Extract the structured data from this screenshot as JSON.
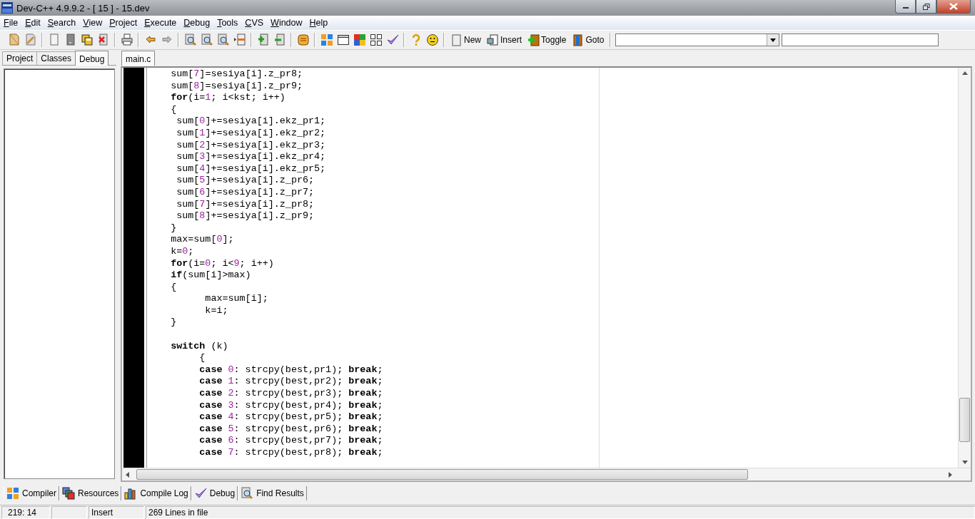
{
  "window": {
    "title": "Dev-C++ 4.9.9.2  - [ 15 ] - 15.dev"
  },
  "menu": [
    "File",
    "Edit",
    "Search",
    "View",
    "Project",
    "Execute",
    "Debug",
    "Tools",
    "CVS",
    "Window",
    "Help"
  ],
  "toolbar": {
    "buttons": [
      "New",
      "Insert",
      "Toggle",
      "Goto"
    ]
  },
  "side_tabs": [
    {
      "label": "Project",
      "selected": false
    },
    {
      "label": "Classes",
      "selected": false
    },
    {
      "label": "Debug",
      "selected": true
    }
  ],
  "editor_tabs": [
    {
      "label": "main.c",
      "selected": true
    }
  ],
  "code": {
    "lines": [
      {
        "kind": "code",
        "segments": [
          {
            "text": "    sum[",
            "kind": "plain"
          },
          {
            "text": "7",
            "kind": "number"
          },
          {
            "text": "]=sesiya[i].z_pr8;",
            "kind": "plain"
          }
        ]
      },
      {
        "kind": "code",
        "segments": [
          {
            "text": "    sum[",
            "kind": "plain"
          },
          {
            "text": "8",
            "kind": "number"
          },
          {
            "text": "]=sesiya[i].z_pr9;",
            "kind": "plain"
          }
        ]
      },
      {
        "kind": "code",
        "segments": [
          {
            "text": "    for",
            "kind": "keyword"
          },
          {
            "text": "(i=",
            "kind": "plain"
          },
          {
            "text": "1",
            "kind": "number"
          },
          {
            "text": "; i<kst; i++)",
            "kind": "plain"
          }
        ]
      },
      {
        "kind": "code",
        "segments": [
          {
            "text": "    {",
            "kind": "plain"
          }
        ]
      },
      {
        "kind": "code",
        "segments": [
          {
            "text": "     sum[",
            "kind": "plain"
          },
          {
            "text": "0",
            "kind": "number"
          },
          {
            "text": "]+=sesiya[i].ekz_pr1;",
            "kind": "plain"
          }
        ]
      },
      {
        "kind": "code",
        "segments": [
          {
            "text": "     sum[",
            "kind": "plain"
          },
          {
            "text": "1",
            "kind": "number"
          },
          {
            "text": "]+=sesiya[i].ekz_pr2;",
            "kind": "plain"
          }
        ]
      },
      {
        "kind": "code",
        "segments": [
          {
            "text": "     sum[",
            "kind": "plain"
          },
          {
            "text": "2",
            "kind": "number"
          },
          {
            "text": "]+=sesiya[i].ekz_pr3;",
            "kind": "plain"
          }
        ]
      },
      {
        "kind": "code",
        "segments": [
          {
            "text": "     sum[",
            "kind": "plain"
          },
          {
            "text": "3",
            "kind": "number"
          },
          {
            "text": "]+=sesiya[i].ekz_pr4;",
            "kind": "plain"
          }
        ]
      },
      {
        "kind": "code",
        "segments": [
          {
            "text": "     sum[",
            "kind": "plain"
          },
          {
            "text": "4",
            "kind": "number"
          },
          {
            "text": "]+=sesiya[i].ekz_pr5;",
            "kind": "plain"
          }
        ]
      },
      {
        "kind": "code",
        "segments": [
          {
            "text": "     sum[",
            "kind": "plain"
          },
          {
            "text": "5",
            "kind": "number"
          },
          {
            "text": "]+=sesiya[i].z_pr6;",
            "kind": "plain"
          }
        ]
      },
      {
        "kind": "code",
        "segments": [
          {
            "text": "     sum[",
            "kind": "plain"
          },
          {
            "text": "6",
            "kind": "number"
          },
          {
            "text": "]+=sesiya[i].z_pr7;",
            "kind": "plain"
          }
        ]
      },
      {
        "kind": "code",
        "segments": [
          {
            "text": "     sum[",
            "kind": "plain"
          },
          {
            "text": "7",
            "kind": "number"
          },
          {
            "text": "]+=sesiya[i].z_pr8;",
            "kind": "plain"
          }
        ]
      },
      {
        "kind": "code",
        "segments": [
          {
            "text": "     sum[",
            "kind": "plain"
          },
          {
            "text": "8",
            "kind": "number"
          },
          {
            "text": "]+=sesiya[i].z_pr9;",
            "kind": "plain"
          }
        ]
      },
      {
        "kind": "code",
        "segments": [
          {
            "text": "    }",
            "kind": "plain"
          }
        ]
      },
      {
        "kind": "code",
        "segments": [
          {
            "text": "    max=sum[",
            "kind": "plain"
          },
          {
            "text": "0",
            "kind": "number"
          },
          {
            "text": "];",
            "kind": "plain"
          }
        ]
      },
      {
        "kind": "code",
        "segments": [
          {
            "text": "    k=",
            "kind": "plain"
          },
          {
            "text": "0",
            "kind": "number"
          },
          {
            "text": ";",
            "kind": "plain"
          }
        ]
      },
      {
        "kind": "code",
        "segments": [
          {
            "text": "    for",
            "kind": "keyword"
          },
          {
            "text": "(i=",
            "kind": "plain"
          },
          {
            "text": "0",
            "kind": "number"
          },
          {
            "text": "; i<",
            "kind": "plain"
          },
          {
            "text": "9",
            "kind": "number"
          },
          {
            "text": "; i++)",
            "kind": "plain"
          }
        ]
      },
      {
        "kind": "code",
        "segments": [
          {
            "text": "    if",
            "kind": "keyword"
          },
          {
            "text": "(sum[i]>max)",
            "kind": "plain"
          }
        ]
      },
      {
        "kind": "code",
        "segments": [
          {
            "text": "    {",
            "kind": "plain"
          }
        ]
      },
      {
        "kind": "code",
        "segments": [
          {
            "text": "          max=sum[i];",
            "kind": "plain"
          }
        ]
      },
      {
        "kind": "code",
        "segments": [
          {
            "text": "          k=i;",
            "kind": "plain"
          }
        ]
      },
      {
        "kind": "code",
        "segments": [
          {
            "text": "    }",
            "kind": "plain"
          }
        ]
      },
      {
        "kind": "blank"
      },
      {
        "kind": "code",
        "segments": [
          {
            "text": "    switch",
            "kind": "keyword"
          },
          {
            "text": " (k)",
            "kind": "plain"
          }
        ]
      },
      {
        "kind": "code",
        "segments": [
          {
            "text": "         {",
            "kind": "plain"
          }
        ]
      },
      {
        "kind": "code",
        "segments": [
          {
            "text": "         case ",
            "kind": "keyword"
          },
          {
            "text": "0",
            "kind": "number"
          },
          {
            "text": ": strcpy(best,pr1); ",
            "kind": "plain"
          },
          {
            "text": "break",
            "kind": "keyword"
          },
          {
            "text": ";",
            "kind": "plain"
          }
        ]
      },
      {
        "kind": "code",
        "segments": [
          {
            "text": "         case ",
            "kind": "keyword"
          },
          {
            "text": "1",
            "kind": "number"
          },
          {
            "text": ": strcpy(best,pr2); ",
            "kind": "plain"
          },
          {
            "text": "break",
            "kind": "keyword"
          },
          {
            "text": ";",
            "kind": "plain"
          }
        ]
      },
      {
        "kind": "code",
        "segments": [
          {
            "text": "         case ",
            "kind": "keyword"
          },
          {
            "text": "2",
            "kind": "number"
          },
          {
            "text": ": strcpy(best,pr3); ",
            "kind": "plain"
          },
          {
            "text": "break",
            "kind": "keyword"
          },
          {
            "text": ";",
            "kind": "plain"
          }
        ]
      },
      {
        "kind": "code",
        "segments": [
          {
            "text": "         case ",
            "kind": "keyword"
          },
          {
            "text": "3",
            "kind": "number"
          },
          {
            "text": ": strcpy(best,pr4); ",
            "kind": "plain"
          },
          {
            "text": "break",
            "kind": "keyword"
          },
          {
            "text": ";",
            "kind": "plain"
          }
        ]
      },
      {
        "kind": "code",
        "segments": [
          {
            "text": "         case ",
            "kind": "keyword"
          },
          {
            "text": "4",
            "kind": "number"
          },
          {
            "text": ": strcpy(best,pr5); ",
            "kind": "plain"
          },
          {
            "text": "break",
            "kind": "keyword"
          },
          {
            "text": ";",
            "kind": "plain"
          }
        ]
      },
      {
        "kind": "code",
        "segments": [
          {
            "text": "         case ",
            "kind": "keyword"
          },
          {
            "text": "5",
            "kind": "number"
          },
          {
            "text": ": strcpy(best,pr6); ",
            "kind": "plain"
          },
          {
            "text": "break",
            "kind": "keyword"
          },
          {
            "text": ";",
            "kind": "plain"
          }
        ]
      },
      {
        "kind": "code",
        "segments": [
          {
            "text": "         case ",
            "kind": "keyword"
          },
          {
            "text": "6",
            "kind": "number"
          },
          {
            "text": ": strcpy(best,pr7); ",
            "kind": "plain"
          },
          {
            "text": "break",
            "kind": "keyword"
          },
          {
            "text": ";",
            "kind": "plain"
          }
        ]
      },
      {
        "kind": "code",
        "segments": [
          {
            "text": "         case ",
            "kind": "keyword"
          },
          {
            "text": "7",
            "kind": "number"
          },
          {
            "text": ": strcpy(best,pr8); ",
            "kind": "plain"
          },
          {
            "text": "break",
            "kind": "keyword"
          },
          {
            "text": ";",
            "kind": "plain"
          }
        ]
      }
    ]
  },
  "bottom_tabs": [
    "Compiler",
    "Resources",
    "Compile Log",
    "Debug",
    "Find Results"
  ],
  "status_bar": {
    "position": "219: 14",
    "mode": "Insert",
    "message": "269 Lines in file"
  }
}
